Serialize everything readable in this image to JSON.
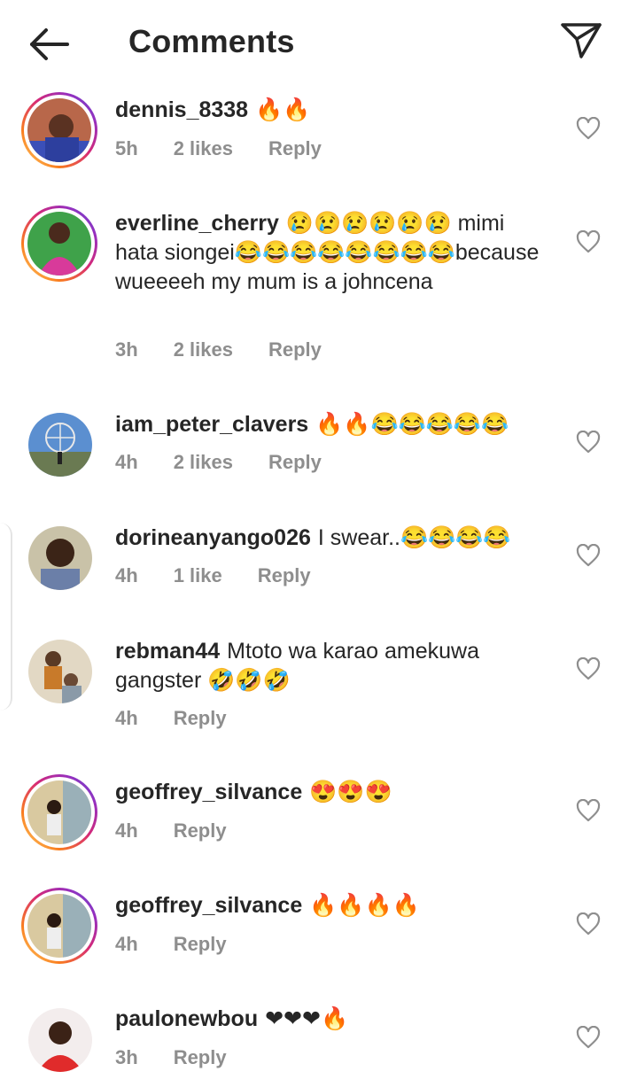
{
  "header": {
    "title": "Comments",
    "back_icon": "arrow-left-icon",
    "send_icon": "paper-plane-icon"
  },
  "comments": [
    {
      "username": "dennis_8338",
      "text": "🔥🔥",
      "time": "5h",
      "likes": "2 likes",
      "reply": "Reply",
      "avatar": "dennis-avatar"
    },
    {
      "username": "everline_cherry",
      "text": "😢😢😢😢😢😢 mimi hata siongei😂😂😂😂😂😂😂😂because wueeeeh my mum is a johncena",
      "time": "3h",
      "likes": "2 likes",
      "reply": "Reply",
      "avatar": "everline-avatar"
    },
    {
      "username": "iam_peter_clavers",
      "text": "🔥🔥😂😂😂😂😂",
      "time": "4h",
      "likes": "2 likes",
      "reply": "Reply",
      "avatar": "ferris-wheel-avatar"
    },
    {
      "username": "dorineanyango026",
      "text": "I swear..😂😂😂😂",
      "time": "4h",
      "likes": "1 like",
      "reply": "Reply",
      "avatar": "dorine-avatar"
    },
    {
      "username": "rebman44",
      "text": "Mtoto wa karao amekuwa gangster 🤣🤣🤣",
      "time": "4h",
      "reply": "Reply",
      "avatar": "rebman-avatar"
    },
    {
      "username": "geoffrey_silvance",
      "text": "😍😍😍",
      "time": "4h",
      "reply": "Reply",
      "avatar": "geoffrey-avatar"
    },
    {
      "username": "geoffrey_silvance",
      "text": "🔥🔥🔥🔥",
      "time": "4h",
      "reply": "Reply",
      "avatar": "geoffrey-avatar"
    },
    {
      "username": "paulonewbou",
      "text": "❤❤❤🔥",
      "time": "3h",
      "reply": "Reply",
      "avatar": "paulo-avatar"
    }
  ],
  "icons": {
    "like": "heart-outline-icon"
  },
  "colors": {
    "text": "#262626",
    "meta": "#8e8e8e",
    "story_ring_start": "#feda75",
    "story_ring_end": "#d62976"
  }
}
